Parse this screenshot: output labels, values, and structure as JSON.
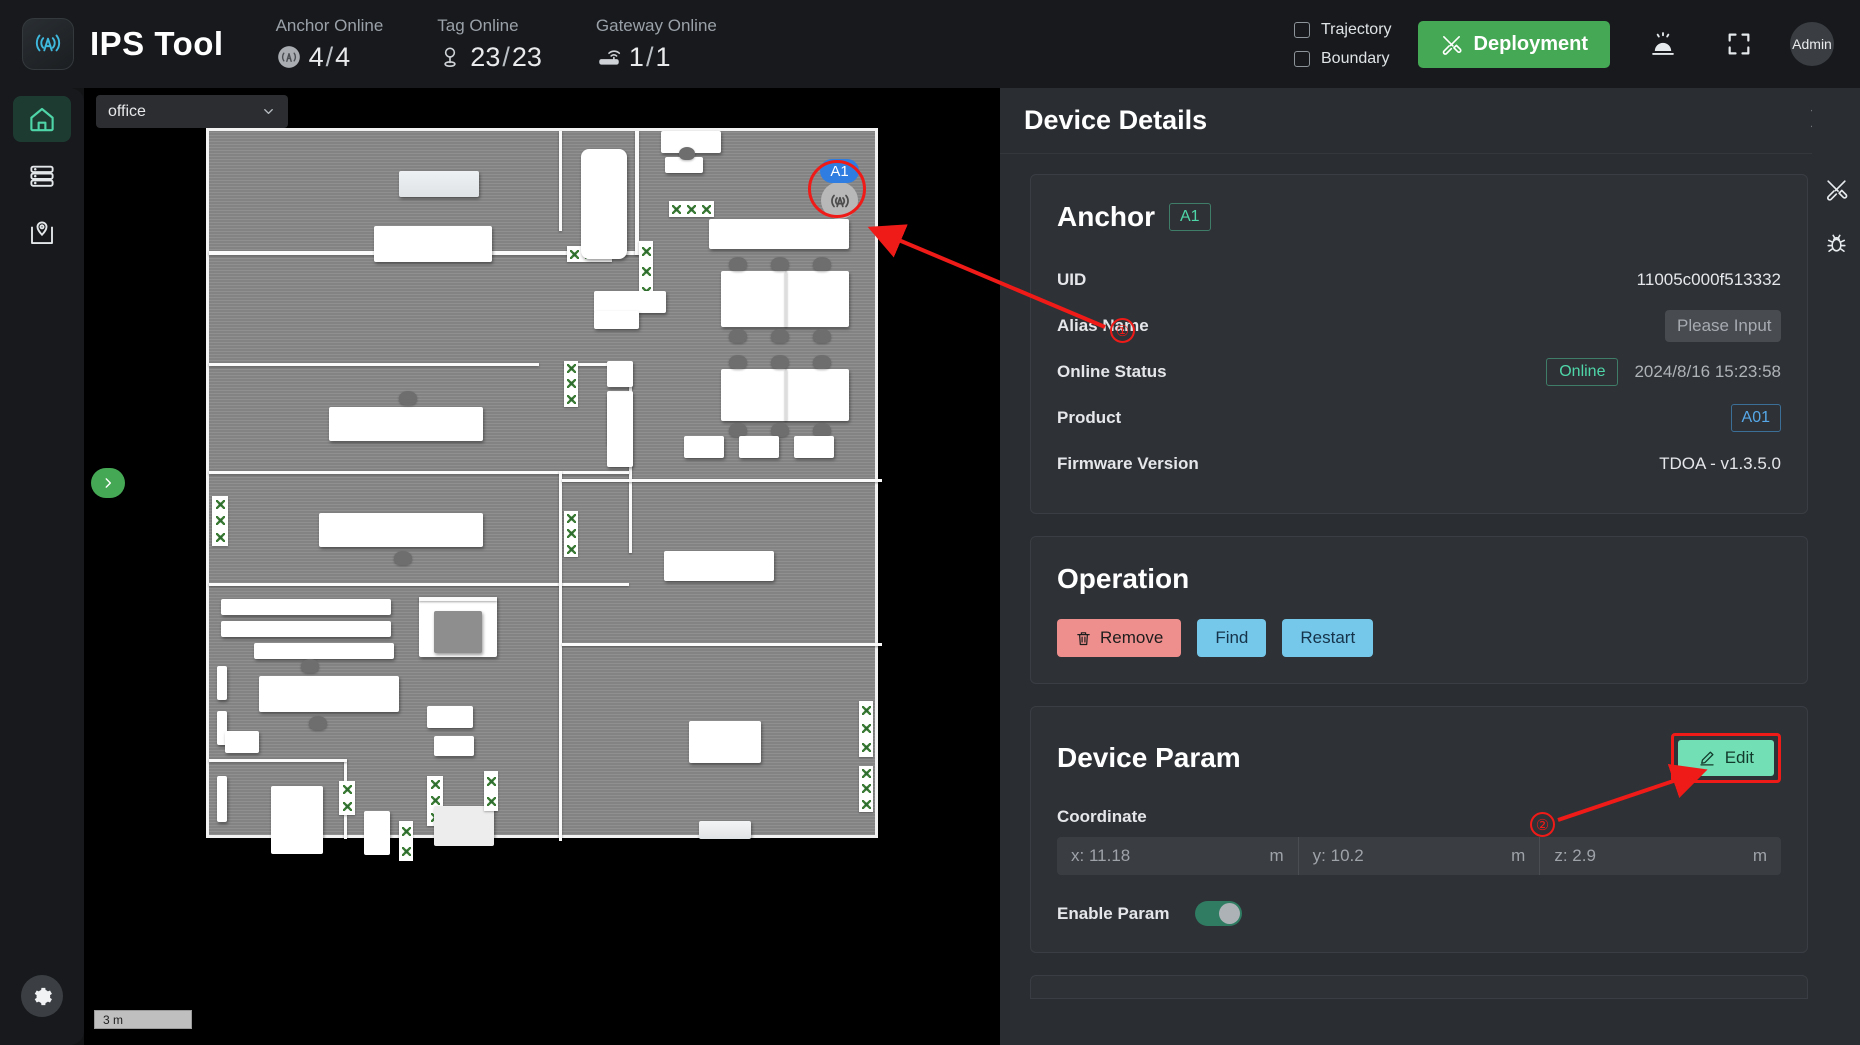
{
  "header": {
    "app_title": "IPS Tool",
    "logo_icon": "antenna-icon",
    "stats": [
      {
        "label": "Anchor Online",
        "icon": "anchor-icon",
        "online": "4",
        "total": "4"
      },
      {
        "label": "Tag Online",
        "icon": "tag-pin-icon",
        "online": "23",
        "total": "23"
      },
      {
        "label": "Gateway Online",
        "icon": "gateway-router-icon",
        "online": "1",
        "total": "1"
      }
    ],
    "separator": "/",
    "checkboxes": [
      {
        "label": "Trajectory",
        "checked": false
      },
      {
        "label": "Boundary",
        "checked": false
      }
    ],
    "deployment_button": {
      "label": "Deployment",
      "icon": "tools-icon",
      "color": "#45a854"
    },
    "alarm_icon": "alarm-bell-icon",
    "fullscreen_icon": "fullscreen-icon",
    "avatar_label": "Admin"
  },
  "sidebar": {
    "items": [
      {
        "name": "home",
        "icon": "home-icon",
        "active": true
      },
      {
        "name": "devices",
        "icon": "server-list-icon",
        "active": false
      },
      {
        "name": "map",
        "icon": "map-pin-icon",
        "active": false
      }
    ],
    "settings_icon": "gear-icon"
  },
  "map": {
    "site_select": {
      "value": "office",
      "icon": "chevron-down-icon"
    },
    "expander_icon": "chevron-right-icon",
    "scale_label": "3 m",
    "anchor_marker": {
      "label": "A1",
      "icon": "anchor-signal-icon"
    }
  },
  "annotations": [
    {
      "number": "①"
    },
    {
      "number": "②"
    }
  ],
  "panel": {
    "title": "Device Details",
    "close_icon": "close-icon",
    "anchor_card": {
      "title": "Anchor",
      "tag": "A1",
      "rows": [
        {
          "label": "UID",
          "value": "11005c000f513332"
        },
        {
          "label": "Alias Name",
          "placeholder": "Please Input"
        },
        {
          "label": "Online Status",
          "badge": "Online",
          "value": "2024/8/16 15:23:58"
        },
        {
          "label": "Product",
          "badge_blue": "A01"
        },
        {
          "label": "Firmware Version",
          "value": "TDOA - v1.3.5.0"
        }
      ]
    },
    "operation_card": {
      "title": "Operation",
      "buttons": [
        {
          "label": "Remove",
          "icon": "trash-icon",
          "style": "danger"
        },
        {
          "label": "Find",
          "style": "primary"
        },
        {
          "label": "Restart",
          "style": "primary"
        }
      ]
    },
    "device_param_card": {
      "title": "Device Param",
      "edit_button": {
        "label": "Edit",
        "icon": "pencil-icon"
      },
      "coordinate_label": "Coordinate",
      "coordinates": [
        {
          "value": "x: 11.18",
          "unit": "m"
        },
        {
          "value": "y: 10.2",
          "unit": "m"
        },
        {
          "value": "z: 2.9",
          "unit": "m"
        }
      ],
      "enable_param": {
        "label": "Enable Param",
        "on": true
      }
    }
  },
  "right_tools": [
    {
      "name": "deploy-tools",
      "icon": "tools-icon"
    },
    {
      "name": "debug",
      "icon": "bug-icon"
    }
  ]
}
